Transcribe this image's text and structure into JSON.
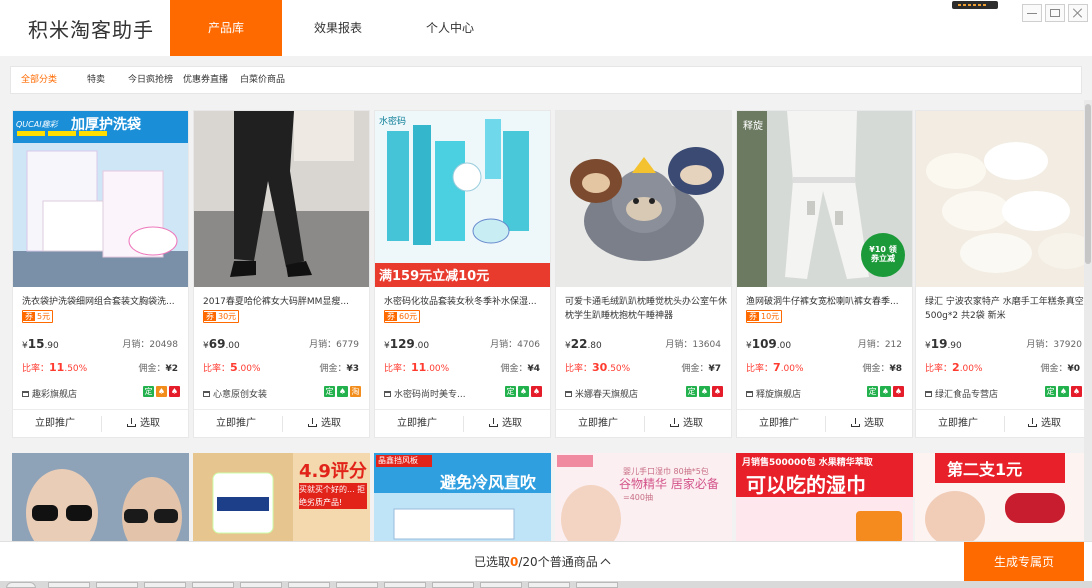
{
  "app": {
    "brand": "积米淘客助手"
  },
  "nav": [
    {
      "label": "产品库",
      "active": true
    },
    {
      "label": "效果报表",
      "active": false
    },
    {
      "label": "个人中心",
      "active": false
    }
  ],
  "categories": [
    "全部分类",
    "特卖",
    "今日疯抢榜",
    "优惠券直播",
    "白菜价商品"
  ],
  "labels": {
    "monthly_sales": "月销",
    "commission": "佣金",
    "ratio": "比率",
    "promote": "立即推广",
    "select": "选取",
    "coupon": "券",
    "currency": "¥"
  },
  "products": [
    {
      "title": "洗衣袋护洗袋细网组合套装文胸袋洗...",
      "coupon": "5元",
      "price_int": "15",
      "price_dec": ".90",
      "sales": "20498",
      "ratio_int": "11",
      "ratio_dec": ".50%",
      "commission": "2",
      "shop": "趣彩旗舰店",
      "banner": "加厚护洗袋",
      "brand_mark": "QUCAI趣彩",
      "badge_set": "green-orange-red"
    },
    {
      "title": "2017春夏哈伦裤女大码胖MM显瘦...",
      "coupon": "30元",
      "price_int": "69",
      "price_dec": ".00",
      "sales": "6779",
      "ratio_int": "5",
      "ratio_dec": ".00%",
      "commission": "3",
      "shop": "心意原创女装",
      "banner": "",
      "brand_mark": "",
      "badge_set": "green-green-orange"
    },
    {
      "title": "水密码化妆品套装女秋冬季补水保湿...",
      "coupon": "60元",
      "price_int": "129",
      "price_dec": ".00",
      "sales": "4706",
      "ratio_int": "11",
      "ratio_dec": ".00%",
      "commission": "4",
      "shop": "水密码尚时美专...",
      "banner": "满159元立减10元",
      "brand_mark": "水密码",
      "badge_set": "green-green-red"
    },
    {
      "title": "可爱卡通毛绒趴趴枕睡觉枕头办公室午休枕学生趴睡枕抱枕午睡神器",
      "coupon": "",
      "price_int": "22",
      "price_dec": ".80",
      "sales": "13604",
      "ratio_int": "30",
      "ratio_dec": ".50%",
      "commission": "7",
      "shop": "米娜春天旗舰店",
      "banner": "",
      "brand_mark": "",
      "badge_set": "green-green-red"
    },
    {
      "title": "渔网破洞牛仔裤女宽松喇叭裤女春季...",
      "coupon": "10元",
      "price_int": "109",
      "price_dec": ".00",
      "sales": "212",
      "ratio_int": "7",
      "ratio_dec": ".00%",
      "commission": "8",
      "shop": "释旋旗舰店",
      "banner": "¥10 领券立减",
      "brand_mark": "释旋",
      "badge_set": "green-green-red"
    },
    {
      "title": "绿汇 宁波农家特产 水磨手工年糕条真空500g*2 共2袋 新米",
      "coupon": "",
      "price_int": "19",
      "price_dec": ".90",
      "sales": "37920",
      "ratio_int": "2",
      "ratio_dec": ".00%",
      "commission": "0",
      "shop": "绿汇食品专营店",
      "banner": "",
      "brand_mark": "",
      "badge_set": "green-green-red"
    }
  ],
  "row2": [
    {
      "text": ""
    },
    {
      "text": "4.9评分",
      "sub": "买就买个好的... 拒绝劣质产品!"
    },
    {
      "text": "避免冷风直吹",
      "sub": "晶鑫挡风板"
    },
    {
      "text": "谷物精华 居家必备",
      "sub": "婴儿手口湿巾 80抽*5包=400抽"
    },
    {
      "text": "可以吃的湿巾",
      "sub": "月销售500000包 水果精华萃取"
    },
    {
      "text": "第二支1元"
    }
  ],
  "footer": {
    "selected_prefix": "已选取",
    "selected_count": "0",
    "selected_suffix": "/20个普通商品",
    "generate": "生成专属页"
  }
}
